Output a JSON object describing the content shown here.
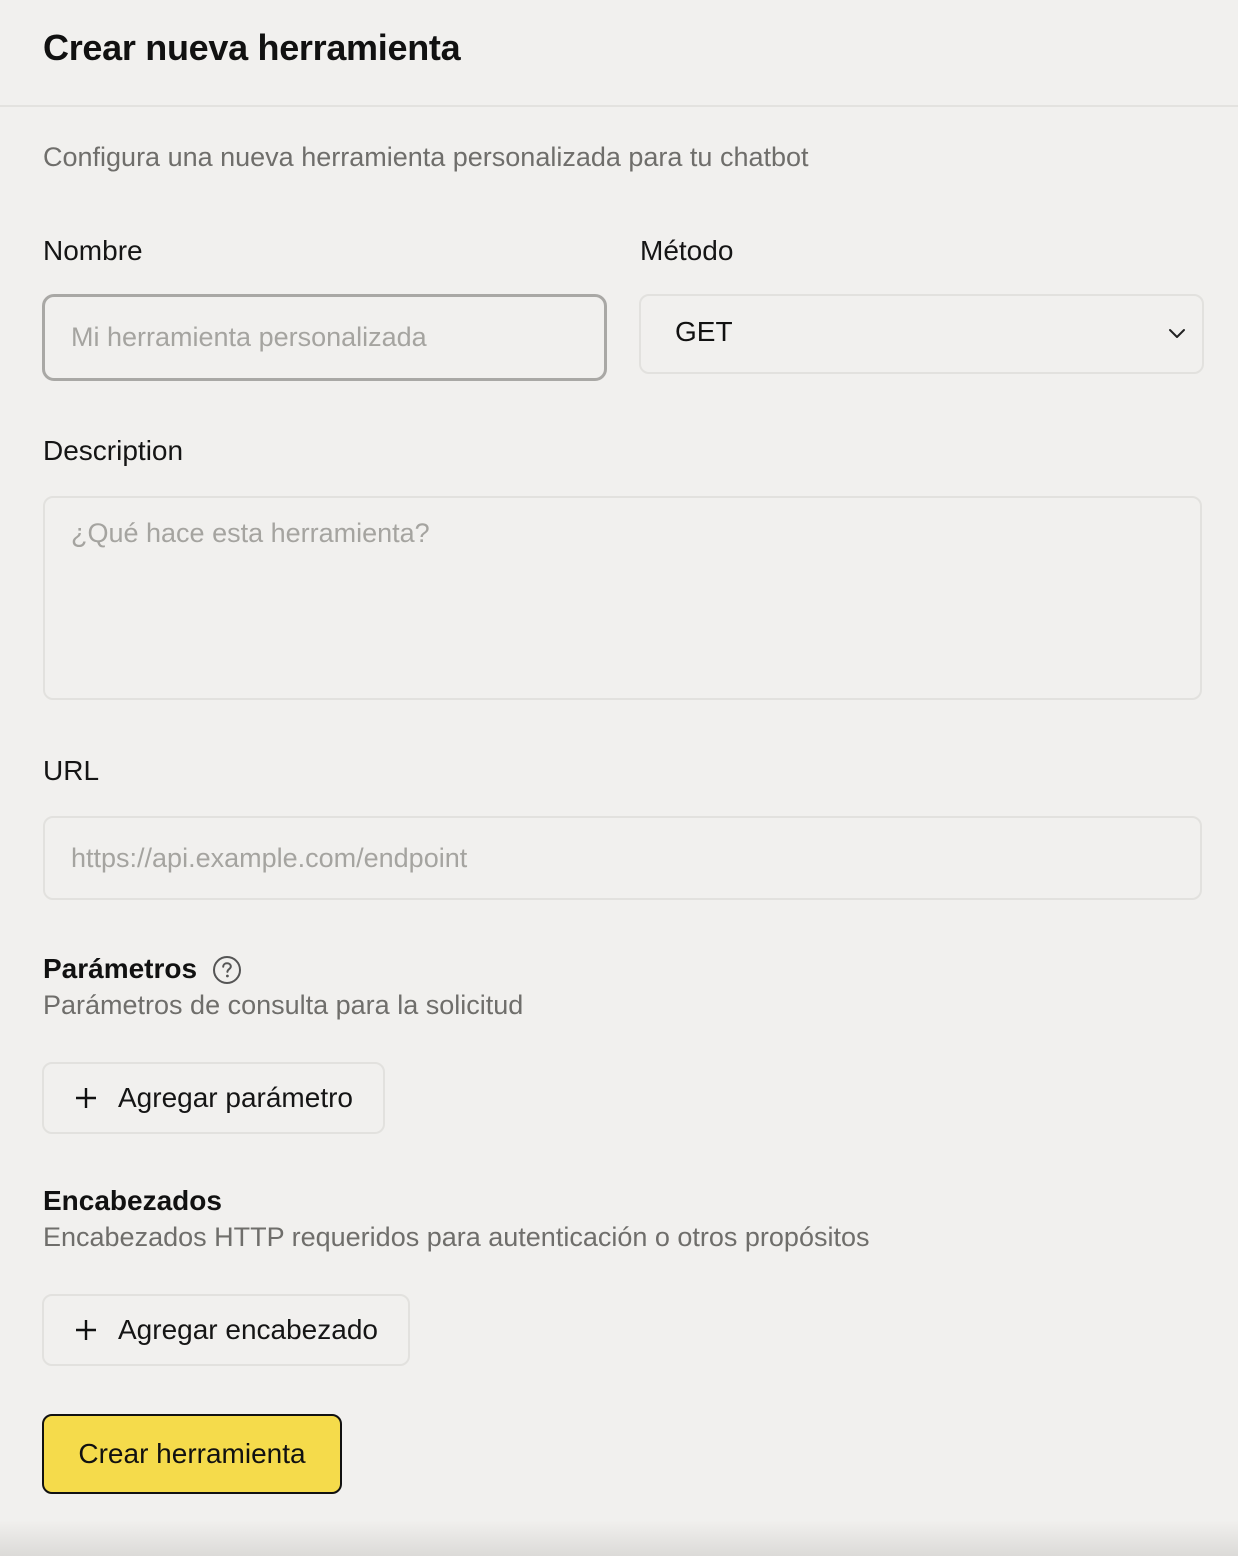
{
  "header": {
    "title": "Crear nueva herramienta"
  },
  "form": {
    "subtitle": "Configura una nueva herramienta personalizada para tu chatbot",
    "name": {
      "label": "Nombre",
      "placeholder": "Mi herramienta personalizada",
      "value": ""
    },
    "method": {
      "label": "Método",
      "selected": "GET",
      "icon": "chevron-down-icon"
    },
    "description": {
      "label": "Description",
      "placeholder": "¿Qué hace esta herramienta?",
      "value": ""
    },
    "url": {
      "label": "URL",
      "placeholder": "https://api.example.com/endpoint",
      "value": ""
    },
    "parameters": {
      "title": "Parámetros",
      "help_icon": "question-circle-icon",
      "description": "Parámetros de consulta para la solicitud",
      "add_label": "Agregar parámetro"
    },
    "headers": {
      "title": "Encabezados",
      "description": "Encabezados HTTP requeridos para autenticación o otros propósitos",
      "add_label": "Agregar encabezado"
    },
    "submit_label": "Crear herramienta"
  },
  "colors": {
    "background": "#f1f0ee",
    "primary_button": "#f5db4b",
    "muted_text": "#6f6e6b"
  }
}
